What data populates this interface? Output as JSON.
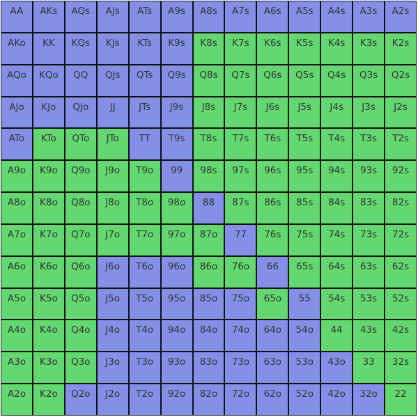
{
  "colors": {
    "blue": "#8490e8",
    "green": "#64d870"
  },
  "ranks": [
    "A",
    "K",
    "Q",
    "J",
    "T",
    "9",
    "8",
    "7",
    "6",
    "5",
    "4",
    "3",
    "2"
  ],
  "grid": [
    "bbbbbbbbbbbbb",
    "bbbbbbggggggg",
    "bbbbbbggggggg",
    "bbbbbbggggggg",
    "bgggbbggggggg",
    "gggggbggggggg",
    "ggggggbgggggg",
    "gggggggbggggg",
    "gggbbbggbgggg",
    "gggbbbbbgbggg",
    "gggbbbbbbbggg",
    "gggbbbbbbbbgg",
    "ggbbbbbbbbbbg"
  ]
}
